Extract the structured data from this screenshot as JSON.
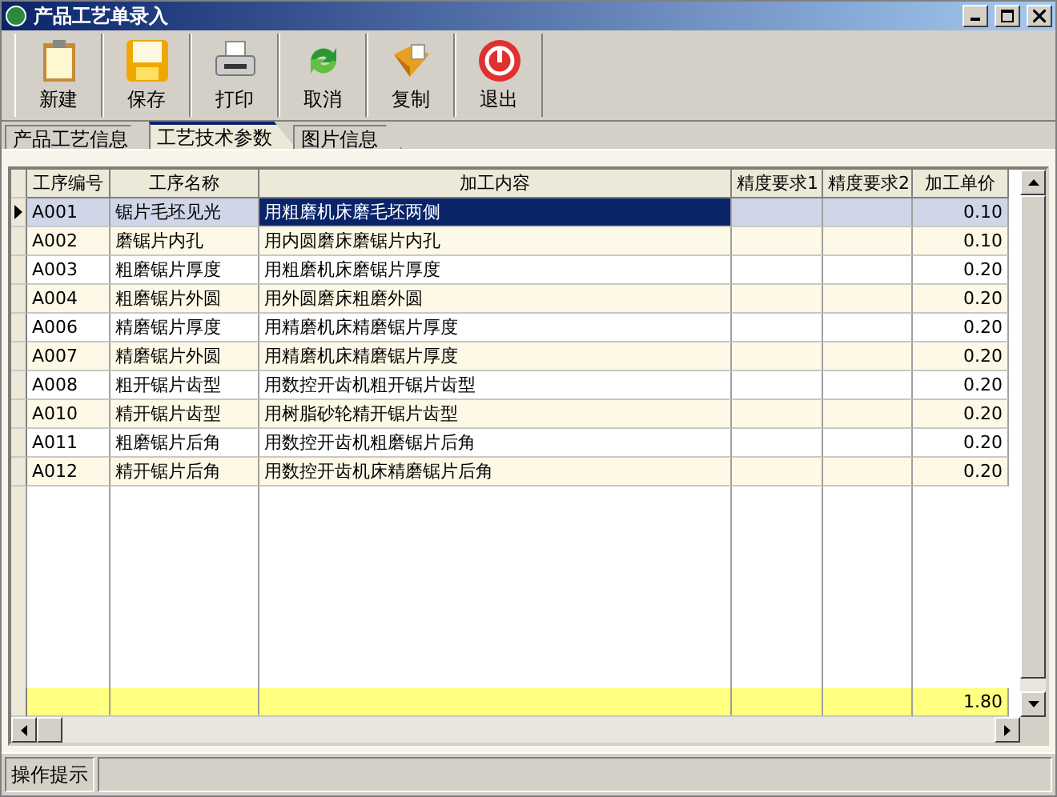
{
  "window": {
    "title": "产品工艺单录入"
  },
  "toolbar": [
    {
      "label": "新建"
    },
    {
      "label": "保存"
    },
    {
      "label": "打印"
    },
    {
      "label": "取消"
    },
    {
      "label": "复制"
    },
    {
      "label": "退出"
    }
  ],
  "tabs": [
    {
      "label": "产品工艺信息",
      "selected": false
    },
    {
      "label": "工艺技术参数",
      "selected": true
    },
    {
      "label": "图片信息",
      "selected": false
    }
  ],
  "table": {
    "columns": [
      "工序编号",
      "工序名称",
      "加工内容",
      "精度要求1",
      "精度要求2",
      "加工单价"
    ],
    "rows": [
      {
        "cells": [
          "A001",
          "锯片毛坯见光",
          "用粗磨机床磨毛坯两侧",
          "",
          "",
          "0.10"
        ],
        "selected": true
      },
      {
        "cells": [
          "A002",
          "磨锯片内孔",
          "用内圆磨床磨锯片内孔",
          "",
          "",
          "0.10"
        ],
        "selected": false
      },
      {
        "cells": [
          "A003",
          "粗磨锯片厚度",
          "用粗磨机床磨锯片厚度",
          "",
          "",
          "0.20"
        ],
        "selected": false
      },
      {
        "cells": [
          "A004",
          "粗磨锯片外圆",
          "用外圆磨床粗磨外圆",
          "",
          "",
          "0.20"
        ],
        "selected": false
      },
      {
        "cells": [
          "A006",
          "精磨锯片厚度",
          "用精磨机床精磨锯片厚度",
          "",
          "",
          "0.20"
        ],
        "selected": false
      },
      {
        "cells": [
          "A007",
          "精磨锯片外圆",
          "用精磨机床精磨锯片厚度",
          "",
          "",
          "0.20"
        ],
        "selected": false
      },
      {
        "cells": [
          "A008",
          "粗开锯片齿型",
          "用数控开齿机粗开锯片齿型",
          "",
          "",
          "0.20"
        ],
        "selected": false
      },
      {
        "cells": [
          "A010",
          "精开锯片齿型",
          "用树脂砂轮精开锯片齿型",
          "",
          "",
          "0.20"
        ],
        "selected": false
      },
      {
        "cells": [
          "A011",
          "粗磨锯片后角",
          "用数控开齿机粗磨锯片后角",
          "",
          "",
          "0.20"
        ],
        "selected": false
      },
      {
        "cells": [
          "A012",
          "精开锯片后角",
          "用数控开齿机床精磨锯片后角",
          "",
          "",
          "0.20"
        ],
        "selected": false
      }
    ],
    "footer": {
      "total": "1.80"
    }
  },
  "status_bar": {
    "label": "操作提示"
  }
}
